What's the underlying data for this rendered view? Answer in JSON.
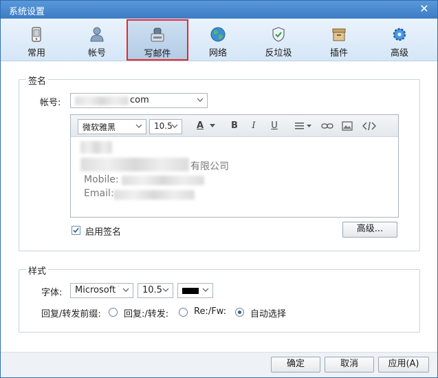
{
  "window": {
    "title": "系统设置",
    "close_glyph": "✕"
  },
  "toolbar": {
    "tabs": [
      {
        "label": "常用",
        "icon": "phone-icon"
      },
      {
        "label": "帐号",
        "icon": "user-icon"
      },
      {
        "label": "写邮件",
        "icon": "compose-icon",
        "active": true
      },
      {
        "label": "网络",
        "icon": "globe-icon"
      },
      {
        "label": "反垃圾",
        "icon": "shield-icon"
      },
      {
        "label": "插件",
        "icon": "plugin-box-icon"
      },
      {
        "label": "高级",
        "icon": "gear-icon"
      }
    ]
  },
  "signature": {
    "group_title": "签名",
    "account_label": "帐号:",
    "account_value": "com",
    "font_value": "微软雅黑",
    "size_value": "10.5",
    "tools": {
      "font_color": "A",
      "bold": "B",
      "italic": "I",
      "underline": "U"
    },
    "content": {
      "company": "有限公司",
      "mobile_label": "Mobile:",
      "email_label": "Email:"
    },
    "enable_label": "启用签名",
    "enable_checked": true,
    "advanced_button": "高级..."
  },
  "style": {
    "group_title": "样式",
    "font_label": "字体:",
    "font_value": "Microsoft Y",
    "size_value": "10.5",
    "color_value": "#000000",
    "prefix_label": "回复/转发前缀:",
    "prefix_options": [
      {
        "label": "回复:/转发:",
        "selected": false
      },
      {
        "label": "Re:/Fw:",
        "selected": false
      },
      {
        "label": "自动选择",
        "selected": true
      }
    ]
  },
  "footer": {
    "ok": "确定",
    "cancel": "取消",
    "apply": "应用(A)"
  },
  "colors": {
    "accent": "#3c7cc4",
    "highlight": "#e8262a"
  }
}
